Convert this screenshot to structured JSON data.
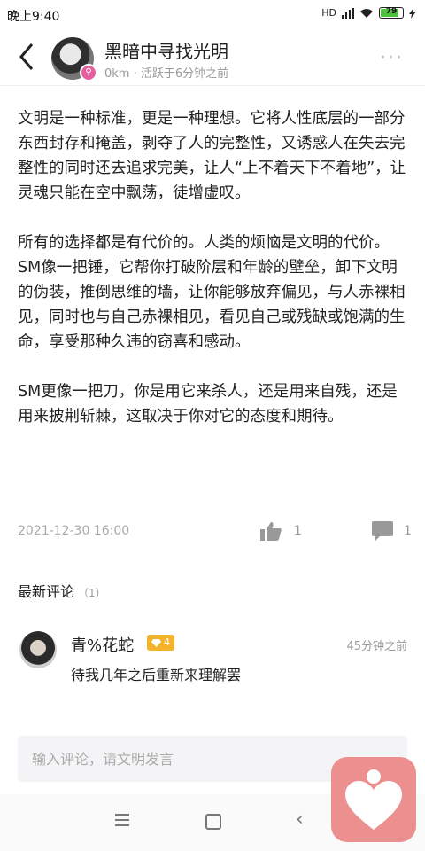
{
  "status_bar": {
    "time": "晚上9:40",
    "network": "HD",
    "battery": "79"
  },
  "header": {
    "back_icon": "chevron-left-icon",
    "username": "黑暗中寻找光明",
    "subtitle": "0km · 活跃于6分钟之前",
    "more_label": "···"
  },
  "post": {
    "paragraphs": [
      "文明是一种标准，更是一种理想。它将人性底层的一部分东西封存和掩盖，剥夺了人的完整性，又诱惑人在失去完整性的同时还去追求完美，让人“上不着天下不着地”，让灵魂只能在空中飘荡，徒增虚叹。",
      "所有的选择都是有代价的。人类的烦恼是文明的代价。",
      "SM像一把锤，它帮你打破阶层和年龄的壁垒，卸下文明的伪装，推倒思维的墙，让你能够放弃偏见，与人赤裸相见，同时也与自己赤裸相见，看见自己或残缺或饱满的生命，享受那种久违的窃喜和感动。",
      "SM更像一把刀，你是用它来杀人，还是用来自残，还是用来披荆斩棘，这取决于你对它的态度和期待。"
    ],
    "date": "2021-12-30 16:00",
    "likes": "1",
    "comments": "1"
  },
  "comments_section": {
    "title": "最新评论",
    "count": "（1）",
    "items": [
      {
        "name": "青%花蛇",
        "badge_level": "4",
        "time": "45分钟之前",
        "text": "待我几年之后重新来理解罢"
      }
    ]
  },
  "input": {
    "placeholder": "输入评论，请文明发言"
  },
  "colors": {
    "accent": "#e55f9e",
    "badge": "#f3b32a",
    "fab": "#ec8f8f"
  }
}
